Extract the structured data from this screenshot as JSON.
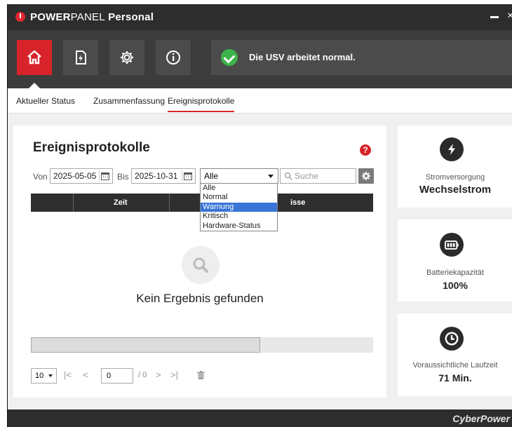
{
  "window": {
    "brand_bold": "POWER",
    "brand_light": "PANEL",
    "title_rest": " Personal",
    "minimize": "minimize",
    "close": "close"
  },
  "toolbar": {
    "buttons": [
      {
        "icon": "home-icon",
        "active": true
      },
      {
        "icon": "energy-report-icon",
        "active": false
      },
      {
        "icon": "gear-icon",
        "active": false
      },
      {
        "icon": "info-icon",
        "active": false
      }
    ],
    "status_text": "Die USV arbeitet normal."
  },
  "tabs": [
    {
      "label": "Aktueller Status",
      "active": false
    },
    {
      "label": "Zusammenfassung",
      "active": false
    },
    {
      "label": "Ereignisprotokolle",
      "active": true
    }
  ],
  "panel": {
    "title": "Ereignisprotokolle",
    "help": "?",
    "from_label": "Von",
    "from_date": "2025-05-05",
    "to_label": "Bis",
    "to_date": "2025-10-31",
    "filter_selected": "Alle",
    "filter_options": [
      "Alle",
      "Normal",
      "Warnung",
      "Kritisch",
      "Hardware-Status"
    ],
    "filter_highlighted": "Warnung",
    "search_placeholder": "Suche",
    "col_time": "Zeit",
    "col_events_partial": "isse",
    "empty_text": "Kein Ergebnis gefunden",
    "page_size": "10",
    "page_input": "0",
    "page_total": "/ 0",
    "nav_first": "|<",
    "nav_prev": "<",
    "nav_next": ">",
    "nav_last": ">|"
  },
  "cards": [
    {
      "icon": "lightning-icon",
      "label": "Stromversorgung",
      "value": "Wechselstrom"
    },
    {
      "icon": "battery-icon",
      "label": "Batteriekapazität",
      "value": "100%"
    },
    {
      "icon": "clock-icon",
      "label": "Voraussichtliche Laufzeit",
      "value": "71 Min."
    }
  ],
  "footer": {
    "brand": "CyberPower"
  },
  "colors": {
    "accent": "#d8232a",
    "ok": "#3cb44a",
    "dark": "#2d2d2d",
    "highlight": "#3875d7"
  }
}
